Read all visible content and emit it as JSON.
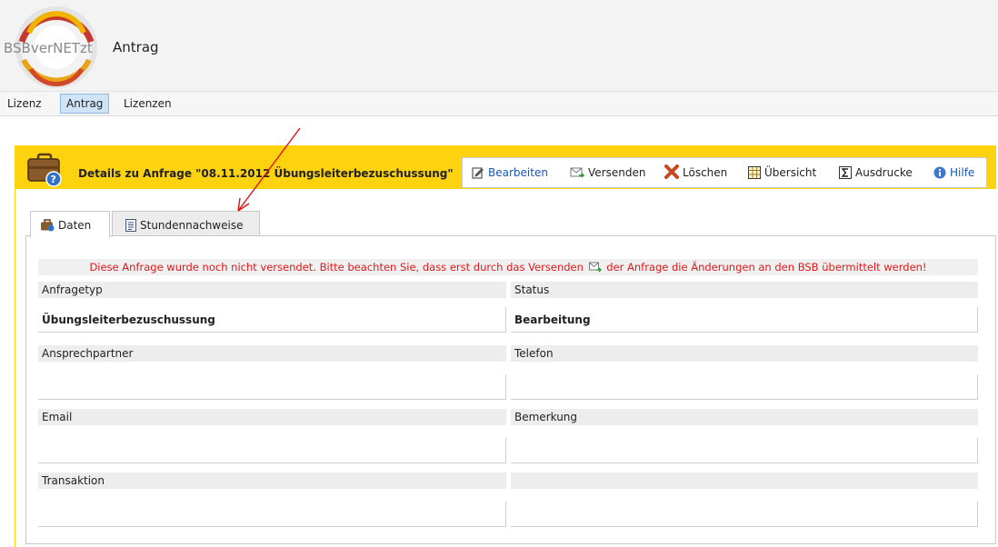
{
  "app": {
    "logo_text": "BSBverNETzt",
    "title": "Antrag"
  },
  "nav": {
    "items": [
      {
        "label": "Lizenz"
      },
      {
        "label": "Antrag"
      },
      {
        "label": "Lizenzen"
      }
    ],
    "active": "Antrag"
  },
  "details": {
    "title": "Details zu  Anfrage \"08.11.2012 Übungsleiterbezuschussung\""
  },
  "toolbar": {
    "bearbeiten": "Bearbeiten",
    "versenden": "Versenden",
    "loeschen": "Löschen",
    "uebersicht": "Übersicht",
    "ausdrucke": "Ausdrucke",
    "hilfe": "Hilfe"
  },
  "tabs": {
    "daten": "Daten",
    "stundennachweise": "Stundennachweise"
  },
  "warning": {
    "part1": "Diese Anfrage wurde noch nicht versendet. Bitte beachten Sie, dass erst durch das Versenden",
    "part2": "der Anfrage die Änderungen an den BSB übermittelt werden!"
  },
  "form": {
    "anfragetyp_label": "Anfragetyp",
    "anfragetyp_value": "Übungsleiterbezuschussung",
    "status_label": "Status",
    "status_value": "Bearbeitung",
    "ansprechpartner_label": "Ansprechpartner",
    "ansprechpartner_value": "",
    "telefon_label": "Telefon",
    "telefon_value": "",
    "email_label": "Email",
    "email_value": "",
    "bemerkung_label": "Bemerkung",
    "bemerkung_value": "",
    "transaktion_label": "Transaktion",
    "transaktion_value": "",
    "empty_label": "",
    "empty_value": ""
  },
  "colors": {
    "accent_yellow": "#fdd20e",
    "warning_red": "#e0191b",
    "link_blue": "#1a56b8"
  }
}
